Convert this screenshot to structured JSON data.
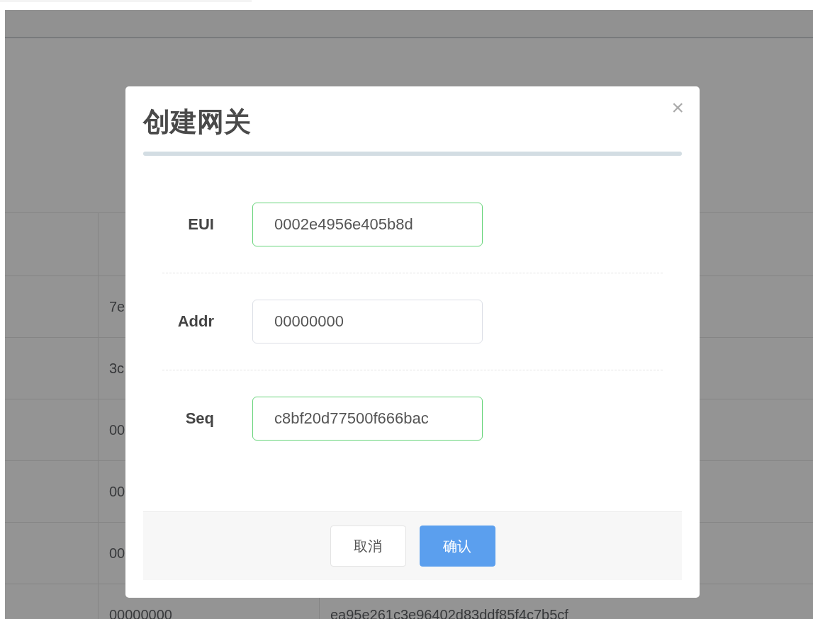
{
  "background_table": {
    "rows": [
      {
        "column_2": "7e"
      },
      {
        "column_2": "3c"
      },
      {
        "column_2": "00"
      },
      {
        "column_2": "00"
      },
      {
        "column_2": "00"
      },
      {
        "column_2": "00000000",
        "column_3": "ea95e261c3e96402d83ddf85f4c7b5cf"
      }
    ]
  },
  "dialog": {
    "title": "创建网关",
    "close": "×",
    "fields": [
      {
        "label": "EUI",
        "value": "0002e4956e405b8d",
        "valid": true
      },
      {
        "label": "Addr",
        "value": "00000000",
        "valid": false
      },
      {
        "label": "Seq",
        "value": "c8bf20d77500f666bac",
        "valid": true
      }
    ],
    "buttons": [
      {
        "label": "取消",
        "kind": "secondary"
      },
      {
        "label": "确认",
        "kind": "primary"
      }
    ]
  }
}
